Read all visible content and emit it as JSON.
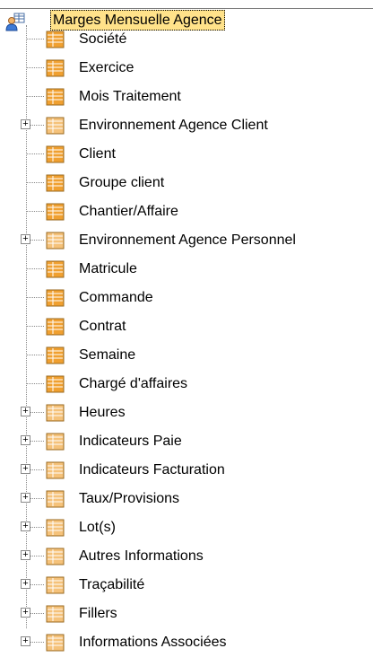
{
  "root": {
    "label": "Marges Mensuelle Agence",
    "icon": "user-db-icon"
  },
  "items": [
    {
      "label": "Société",
      "type": "field",
      "expandable": false
    },
    {
      "label": "Exercice",
      "type": "field",
      "expandable": false
    },
    {
      "label": "Mois Traitement",
      "type": "field",
      "expandable": false
    },
    {
      "label": "Environnement Agence Client",
      "type": "folder",
      "expandable": true
    },
    {
      "label": "Client",
      "type": "field",
      "expandable": false
    },
    {
      "label": "Groupe client",
      "type": "field",
      "expandable": false
    },
    {
      "label": "Chantier/Affaire",
      "type": "field",
      "expandable": false
    },
    {
      "label": "Environnement Agence Personnel",
      "type": "folder",
      "expandable": true
    },
    {
      "label": "Matricule",
      "type": "field",
      "expandable": false
    },
    {
      "label": "Commande",
      "type": "field",
      "expandable": false
    },
    {
      "label": "Contrat",
      "type": "field",
      "expandable": false
    },
    {
      "label": "Semaine",
      "type": "field",
      "expandable": false
    },
    {
      "label": "Chargé d'affaires",
      "type": "field",
      "expandable": false
    },
    {
      "label": "Heures",
      "type": "folder",
      "expandable": true
    },
    {
      "label": "Indicateurs Paie",
      "type": "folder",
      "expandable": true
    },
    {
      "label": "Indicateurs Facturation",
      "type": "folder",
      "expandable": true
    },
    {
      "label": "Taux/Provisions",
      "type": "folder",
      "expandable": true
    },
    {
      "label": "Lot(s)",
      "type": "folder",
      "expandable": true
    },
    {
      "label": "Autres Informations",
      "type": "folder",
      "expandable": true
    },
    {
      "label": "Traçabilité",
      "type": "folder",
      "expandable": true
    },
    {
      "label": "Fillers",
      "type": "folder",
      "expandable": true
    },
    {
      "label": "Informations Associées",
      "type": "folder",
      "expandable": true
    }
  ],
  "icons": {
    "field": "field-table-icon",
    "folder": "folder-table-icon",
    "expander": "plus-box-icon"
  },
  "colors": {
    "selection": "#ffe28a",
    "field_icon": "#f0a030",
    "folder_icon": "#f5c27a"
  }
}
